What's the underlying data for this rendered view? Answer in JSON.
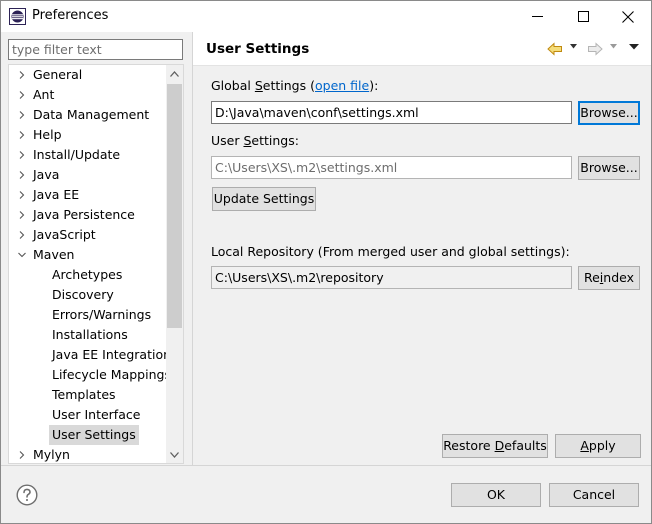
{
  "window": {
    "title": "Preferences"
  },
  "filter": {
    "placeholder": "type filter text"
  },
  "tree": {
    "items": [
      {
        "label": "General",
        "expandable": true,
        "expanded": false,
        "level": 0
      },
      {
        "label": "Ant",
        "expandable": true,
        "expanded": false,
        "level": 0
      },
      {
        "label": "Data Management",
        "expandable": true,
        "expanded": false,
        "level": 0
      },
      {
        "label": "Help",
        "expandable": true,
        "expanded": false,
        "level": 0
      },
      {
        "label": "Install/Update",
        "expandable": true,
        "expanded": false,
        "level": 0
      },
      {
        "label": "Java",
        "expandable": true,
        "expanded": false,
        "level": 0
      },
      {
        "label": "Java EE",
        "expandable": true,
        "expanded": false,
        "level": 0
      },
      {
        "label": "Java Persistence",
        "expandable": true,
        "expanded": false,
        "level": 0
      },
      {
        "label": "JavaScript",
        "expandable": true,
        "expanded": false,
        "level": 0
      },
      {
        "label": "Maven",
        "expandable": true,
        "expanded": true,
        "level": 0
      },
      {
        "label": "Archetypes",
        "expandable": false,
        "level": 1
      },
      {
        "label": "Discovery",
        "expandable": false,
        "level": 1
      },
      {
        "label": "Errors/Warnings",
        "expandable": false,
        "level": 1
      },
      {
        "label": "Installations",
        "expandable": false,
        "level": 1
      },
      {
        "label": "Java EE Integration",
        "expandable": false,
        "level": 1
      },
      {
        "label": "Lifecycle Mappings",
        "expandable": false,
        "level": 1
      },
      {
        "label": "Templates",
        "expandable": false,
        "level": 1
      },
      {
        "label": "User Interface",
        "expandable": false,
        "level": 1
      },
      {
        "label": "User Settings",
        "expandable": false,
        "level": 1,
        "selected": true
      },
      {
        "label": "Mylyn",
        "expandable": true,
        "expanded": false,
        "level": 0
      }
    ]
  },
  "page": {
    "title": "User Settings",
    "global_settings_label_pre": "Global ",
    "global_settings_label_mnemonic": "S",
    "global_settings_label_post": "ettings (",
    "open_file_link": "open file",
    "global_settings_label_end": "):",
    "global_settings_value": "D:\\Java\\maven\\conf\\settings.xml",
    "browse_label_1": "Browse...",
    "user_settings_label_pre": "User ",
    "user_settings_label_mnemonic": "S",
    "user_settings_label_post": "ettings:",
    "user_settings_value": "C:\\Users\\XS\\.m2\\settings.xml",
    "browse_label_2": "Browse...",
    "update_settings_label": "Update Settings",
    "local_repo_label": "Local Repository (From merged user and global settings):",
    "local_repo_value": "C:\\Users\\XS\\.m2\\repository",
    "reindex_pre": "Re",
    "reindex_mnemonic": "i",
    "reindex_post": "ndex",
    "restore_pre": "Restore ",
    "restore_mnemonic": "D",
    "restore_post": "efaults",
    "apply_mnemonic": "A",
    "apply_post": "pply"
  },
  "footer": {
    "ok_label": "OK",
    "cancel_label": "Cancel"
  },
  "colors": {
    "link": "#0066cc",
    "focus_border": "#0078d7",
    "selection": "#d9d9d9",
    "button_bg": "#e1e1e1"
  }
}
